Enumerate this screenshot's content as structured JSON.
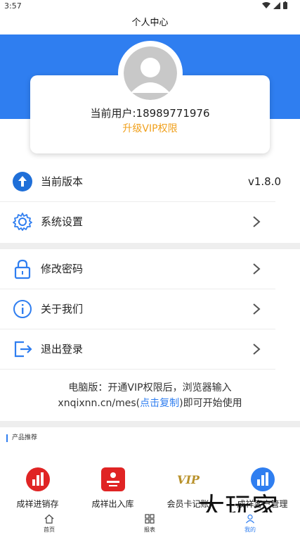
{
  "status_bar": {
    "time": "3:57"
  },
  "header": {
    "title": "个人中心"
  },
  "profile": {
    "user_text": "当前用户:18989771976",
    "vip_text": "升级VIP权限"
  },
  "menu": {
    "version": {
      "label": "当前版本",
      "value": "v1.8.0",
      "icon": "arrow-up-circle-icon"
    },
    "settings": {
      "label": "系统设置",
      "icon": "gear-icon"
    },
    "password": {
      "label": "修改密码",
      "icon": "lock-icon"
    },
    "about": {
      "label": "关于我们",
      "icon": "info-icon"
    },
    "logout": {
      "label": "退出登录",
      "icon": "logout-icon"
    }
  },
  "pc_note": {
    "line1": "电脑版：开通VIP权限后，浏览器输入",
    "prefix": "xnqixnn.cn/mes(",
    "link": "点击复制",
    "suffix": ")即可开始使用"
  },
  "products": {
    "title": "产品推荐",
    "items": [
      {
        "label": "成祥进销存",
        "icon": "chart-bars-icon",
        "color": "#e02424"
      },
      {
        "label": "成祥出入库",
        "icon": "brand-logo-icon",
        "color": "#e02424"
      },
      {
        "label": "会员卡记账",
        "icon": "vip-icon",
        "color": "#b8912a"
      },
      {
        "label": "成祥客户管理",
        "icon": "chart-bars-icon",
        "color": "#2f7ef0"
      }
    ]
  },
  "tabs": [
    {
      "label": "首页",
      "icon": "home-icon"
    },
    {
      "label": "报表",
      "icon": "grid-icon"
    },
    {
      "label": "我的",
      "icon": "user-icon"
    }
  ],
  "watermark": "大玩家",
  "colors": {
    "primary": "#2f7ef0",
    "vip": "#f0a01c"
  }
}
